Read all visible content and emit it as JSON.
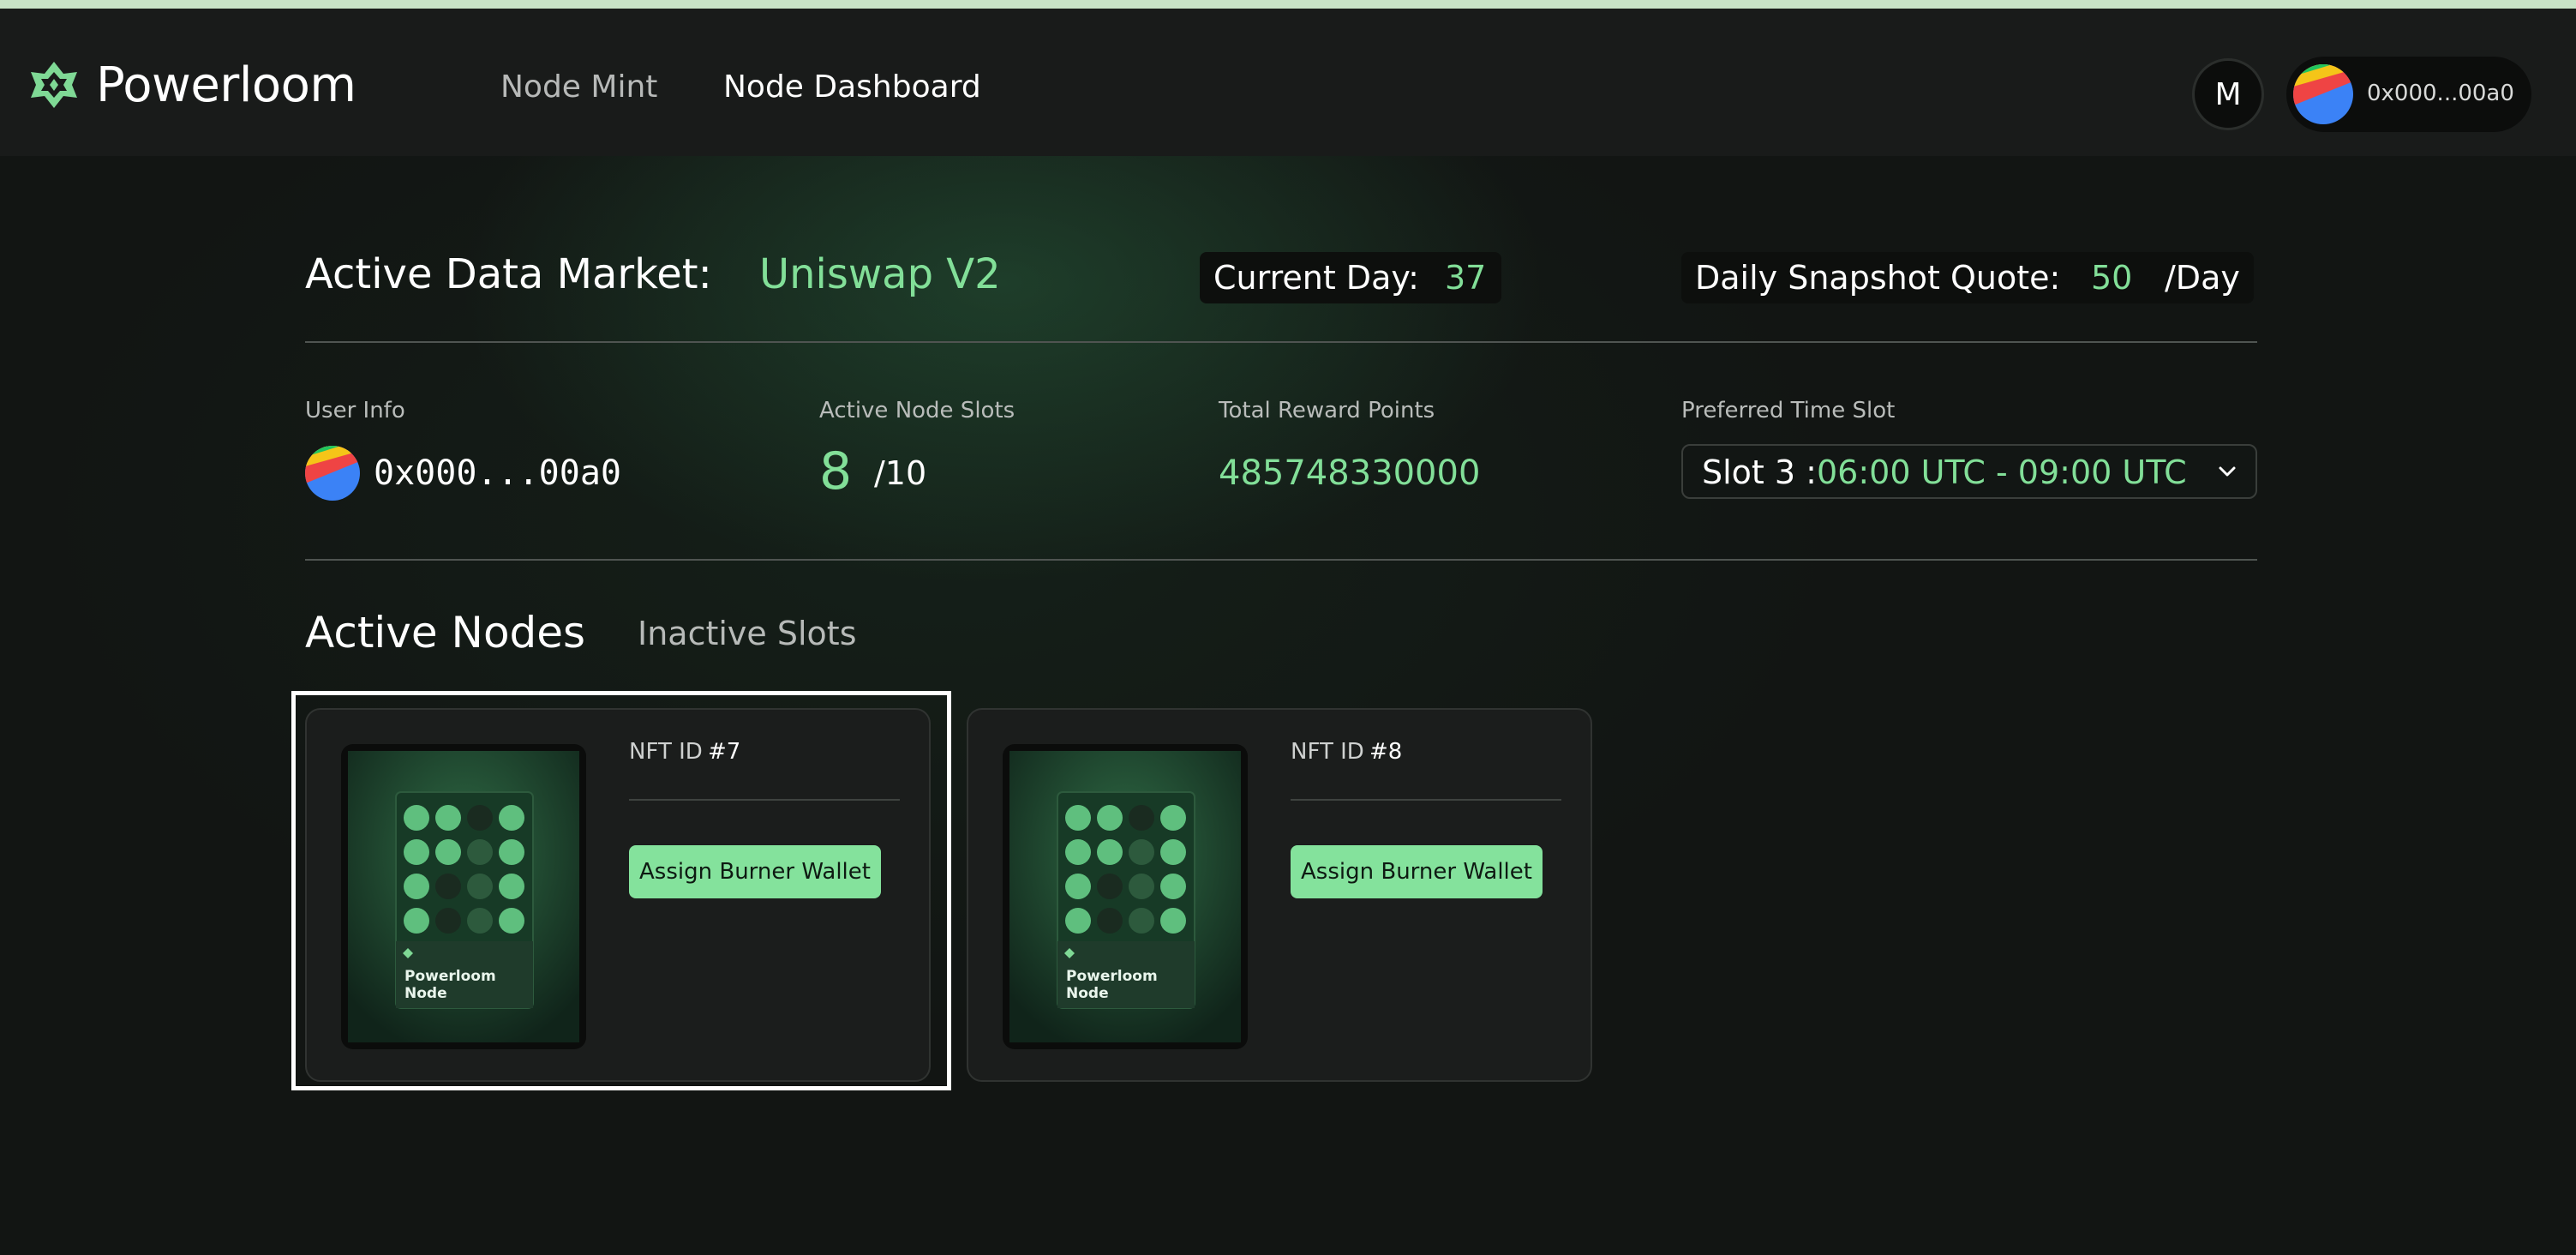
{
  "header": {
    "brand": "Powerloom",
    "nav": [
      {
        "label": "Node Mint"
      },
      {
        "label": "Node Dashboard"
      }
    ],
    "metamask_initial": "M",
    "account_address": "0x000...00a0"
  },
  "market": {
    "label": "Active Data Market:",
    "value": "Uniswap V2",
    "current_day_label": "Current Day:",
    "current_day_value": "37",
    "quote_label": "Daily Snapshot Quote:",
    "quote_value": "50",
    "quote_unit": "/Day"
  },
  "info": {
    "user_label": "User Info",
    "user_address": "0x000...00a0",
    "slots_label": "Active Node Slots",
    "slots_active": "8",
    "slots_total": "/10",
    "reward_label": "Total Reward Points",
    "reward_value": "485748330000",
    "time_slot_label": "Preferred Time Slot",
    "time_slot_prefix": "Slot 3 :",
    "time_slot_value": "06:00 UTC - 09:00 UTC"
  },
  "tabs": {
    "active": "Active Nodes",
    "inactive": "Inactive Slots"
  },
  "nodes": [
    {
      "id_label": "NFT ID",
      "id_value": "#7",
      "button": "Assign Burner Wallet",
      "card_text_1": "Powerloom",
      "card_text_2": "Node"
    },
    {
      "id_label": "NFT ID",
      "id_value": "#8",
      "button": "Assign Burner Wallet",
      "card_text_1": "Powerloom",
      "card_text_2": "Node"
    }
  ],
  "colors": {
    "accent": "#82df98",
    "background": "#121513",
    "header": "#191b1a",
    "card": "#1b1d1c"
  },
  "icons": {
    "logo": "powerloom-logo-icon",
    "metamask": "metamask-icon",
    "avatar": "gradient-avatar-icon",
    "dropdown": "chevron-down-icon"
  }
}
